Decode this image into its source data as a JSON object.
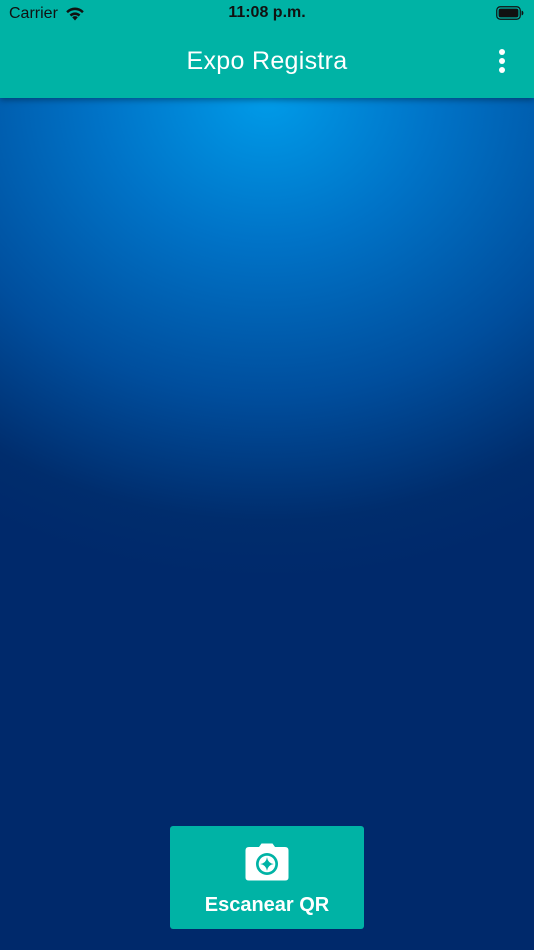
{
  "status_bar": {
    "carrier": "Carrier",
    "time": "11:08 p.m.",
    "wifi_icon": "wifi-icon",
    "battery_icon": "battery-icon"
  },
  "app_bar": {
    "title": "Expo Registra",
    "menu_icon": "more-vertical-icon",
    "background_color": "#00b3a5"
  },
  "content": {
    "gradient_top_color": "#009be8",
    "gradient_bottom_color": "#00296b"
  },
  "scan_button": {
    "label": "Escanear QR",
    "icon": "camera-icon",
    "background_color": "#00b3a5"
  }
}
